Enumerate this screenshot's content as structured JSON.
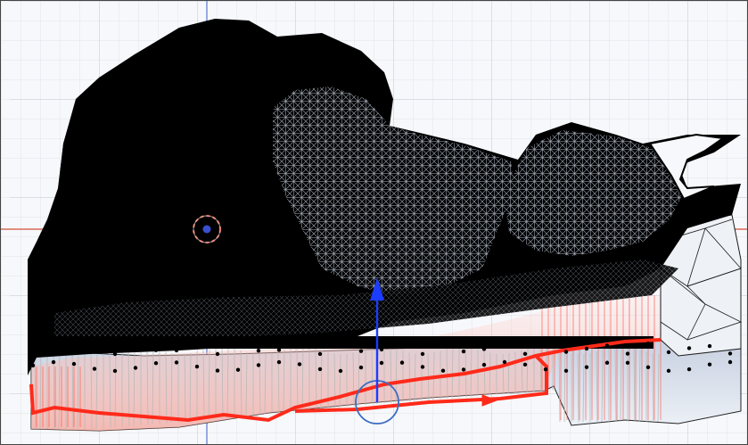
{
  "viewport": {
    "view": "orthographic-front",
    "object_mode": "edit",
    "selected_geometry": "mesh-wireframe",
    "icons": {
      "origin": "3d-cursor-icon",
      "manipulator": "translate-gizmo-icon",
      "arrow": "arrow-up-icon"
    }
  },
  "colors": {
    "background": "#f7f8fb",
    "grid_minor": "#dfe3ea",
    "grid_major": "#c9ced8",
    "x_axis": "#d86a5a",
    "z_axis": "#6f89d8",
    "mesh": "#000000",
    "mesh_highlight": "#c9cfd9",
    "selected_edges": "#ff2a1a",
    "cursor_ring": "#c84a3c",
    "gizmo_z": "#1c3cff",
    "gizmo_ring": "#3d6cc2"
  }
}
